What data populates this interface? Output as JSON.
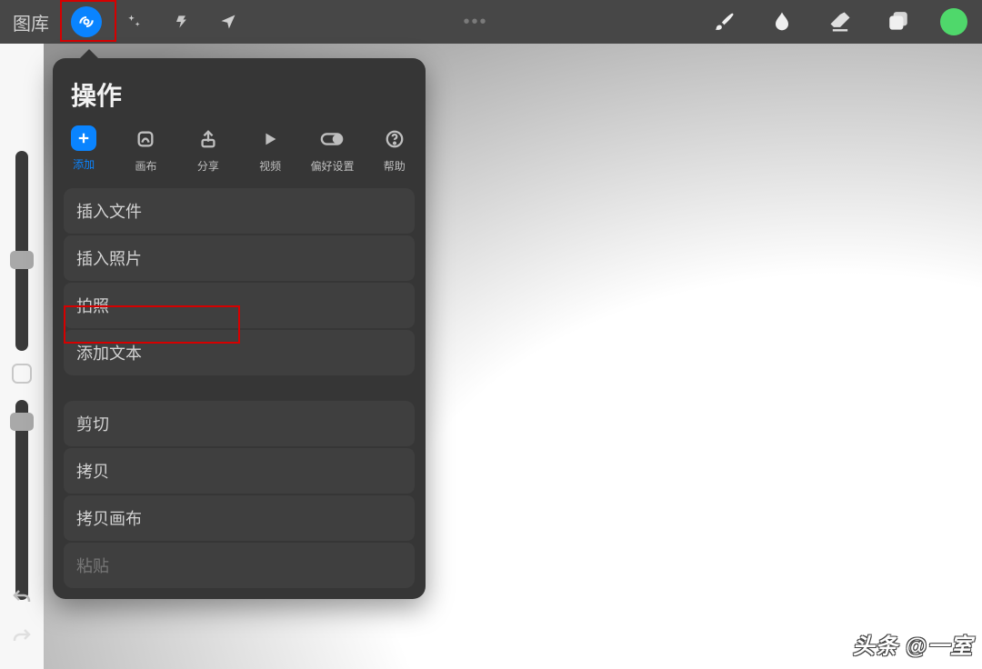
{
  "topbar": {
    "gallery_label": "图库",
    "ellipsis": "•••"
  },
  "popover": {
    "title": "操作",
    "tabs": {
      "add": "添加",
      "canvas": "画布",
      "share": "分享",
      "video": "视频",
      "prefs": "偏好设置",
      "help": "帮助"
    },
    "group1": {
      "insert_file": "插入文件",
      "insert_photo": "插入照片",
      "take_photo": "拍照",
      "add_text": "添加文本"
    },
    "group2": {
      "cut": "剪切",
      "copy": "拷贝",
      "copy_canvas": "拷贝画布",
      "paste": "粘贴"
    }
  },
  "watermark": "头条 @一室",
  "colors": {
    "accent": "#0a84ff",
    "highlight": "#d60000",
    "color_swatch": "#4fd86b"
  }
}
